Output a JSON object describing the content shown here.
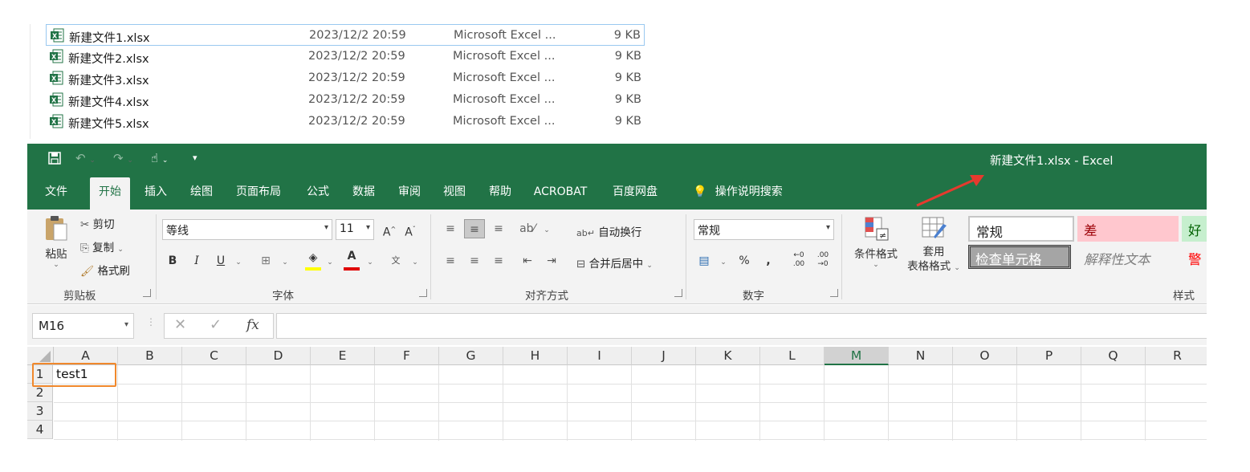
{
  "files": [
    {
      "name": "新建文件1.xlsx",
      "date": "2023/12/2 20:59",
      "type": "Microsoft Excel ...",
      "size": "9 KB",
      "selected": true
    },
    {
      "name": "新建文件2.xlsx",
      "date": "2023/12/2 20:59",
      "type": "Microsoft Excel ...",
      "size": "9 KB"
    },
    {
      "name": "新建文件3.xlsx",
      "date": "2023/12/2 20:59",
      "type": "Microsoft Excel ...",
      "size": "9 KB"
    },
    {
      "name": "新建文件4.xlsx",
      "date": "2023/12/2 20:59",
      "type": "Microsoft Excel ...",
      "size": "9 KB"
    },
    {
      "name": "新建文件5.xlsx",
      "date": "2023/12/2 20:59",
      "type": "Microsoft Excel ...",
      "size": "9 KB"
    }
  ],
  "excel": {
    "window_title": "新建文件1.xlsx  -  Excel",
    "tabs": [
      "文件",
      "开始",
      "插入",
      "绘图",
      "页面布局",
      "公式",
      "数据",
      "审阅",
      "视图",
      "帮助",
      "ACROBAT",
      "百度网盘"
    ],
    "active_tab": "开始",
    "tell_me": "操作说明搜索",
    "clipboard": {
      "paste": "粘贴",
      "cut": "剪切",
      "copy": "复制",
      "format_painter": "格式刷",
      "label": "剪贴板"
    },
    "font": {
      "name": "等线",
      "size": "11",
      "bold": "B",
      "italic": "I",
      "underline": "U",
      "label": "字体"
    },
    "alignment": {
      "wrap": "自动换行",
      "merge": "合并后居中",
      "label": "对齐方式"
    },
    "number": {
      "format": "常规",
      "percent": "%",
      "comma": ",",
      "label": "数字"
    },
    "styles": {
      "conditional": "条件格式",
      "table_format_1": "套用",
      "table_format_2": "表格格式",
      "normal": "常规",
      "bad": "差",
      "good": "好",
      "check_cell": "检查单元格",
      "explanatory": "解释性文本",
      "warning": "警",
      "label": "样式"
    },
    "name_box": "M16",
    "columns": [
      "A",
      "B",
      "C",
      "D",
      "E",
      "F",
      "G",
      "H",
      "I",
      "J",
      "K",
      "L",
      "M",
      "N",
      "O",
      "P",
      "Q",
      "R"
    ],
    "selected_column": "M",
    "rows": [
      "1",
      "2",
      "3",
      "4"
    ],
    "cells": {
      "A1": "test1"
    },
    "colors": {
      "excel_green": "#217346",
      "highlight": "#f0882c",
      "arrow": "#e63a2e"
    }
  }
}
